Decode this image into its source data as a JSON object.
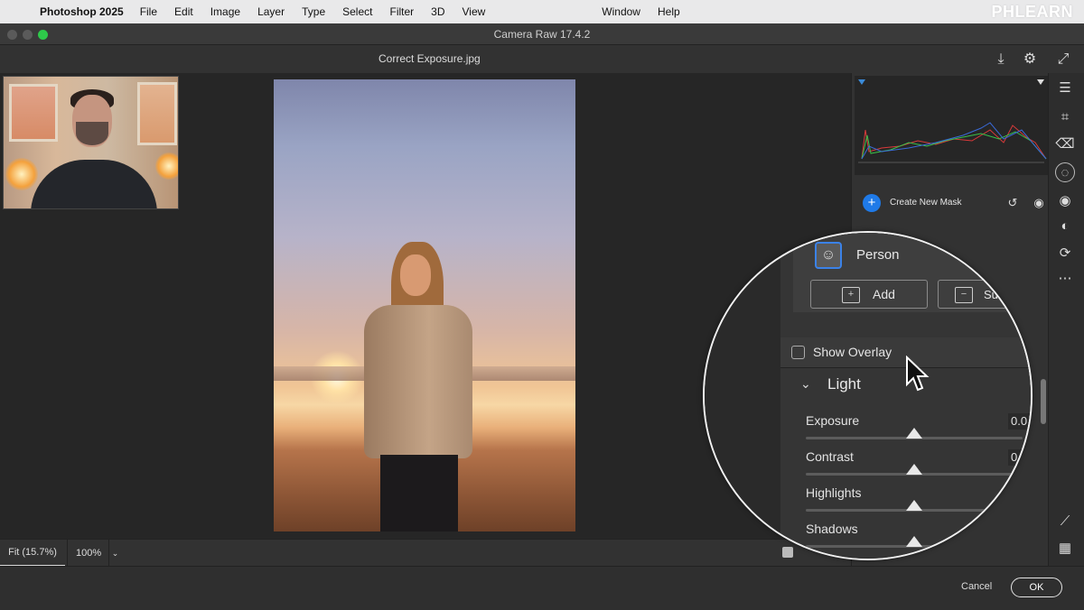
{
  "menubar": {
    "app_name": "Photoshop 2025",
    "items": [
      "File",
      "Edit",
      "Image",
      "Layer",
      "Type",
      "Select",
      "Filter",
      "3D",
      "View"
    ],
    "window": "Window",
    "help": "Help",
    "watermark": "PHLEARN"
  },
  "window": {
    "title": "Camera Raw 17.4.2",
    "filename": "Correct Exposure.jpg"
  },
  "status": {
    "fit_label": "Fit (15.7%)",
    "zoom_label": "100%"
  },
  "masks": {
    "create_new_mask": "Create New Mask",
    "person_label": "Person",
    "add_label": "Add",
    "subtract_label": "Subtract"
  },
  "overlay": {
    "show_overlay_label": "Show Overlay",
    "checked": false
  },
  "light": {
    "section_label": "Light",
    "sliders": [
      {
        "label": "Exposure",
        "value": "0.0",
        "level": 0.5
      },
      {
        "label": "Contrast",
        "value": "0",
        "level": 0.5
      },
      {
        "label": "Highlights",
        "value": "",
        "level": 0.5
      },
      {
        "label": "Shadows",
        "value": "",
        "level": 0.5
      }
    ]
  },
  "footer": {
    "cancel": "Cancel",
    "ok": "OK"
  },
  "icons": {
    "accent": "#1f7ae8",
    "tools": [
      "sliders-icon",
      "crop-icon",
      "eraser-icon",
      "mask-icon",
      "redeye-icon",
      "presets-icon",
      "refresh-icon",
      "more-icon",
      "eyedropper-icon",
      "grid-icon"
    ]
  }
}
